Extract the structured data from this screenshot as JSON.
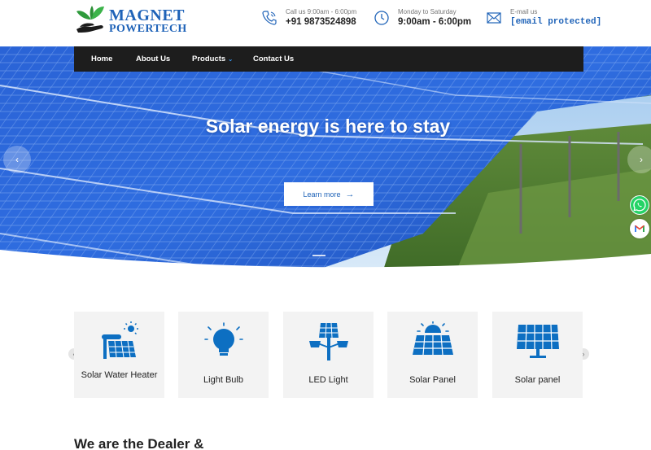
{
  "brand": {
    "line1": "MAGNET",
    "line2": "POWERTECH",
    "logo_icon": "leaf-hand-logo"
  },
  "contact": {
    "phone": {
      "label": "Call us 9:00am - 6:00pm",
      "value": "+91 9873524898",
      "icon": "phone-icon"
    },
    "hours": {
      "label": "Monday to Saturday",
      "value": "9:00am - 6:00pm",
      "icon": "clock-icon"
    },
    "email": {
      "label": "E-mail us",
      "value": "[email protected]",
      "icon": "mail-icon"
    }
  },
  "nav": {
    "items": [
      {
        "label": "Home"
      },
      {
        "label": "About Us"
      },
      {
        "label": "Products",
        "caret": "⌄"
      },
      {
        "label": "Contact Us"
      }
    ]
  },
  "hero": {
    "title": "Solar energy is here to stay",
    "button_label": "Learn more",
    "button_icon": "arrow-right-icon",
    "prev_icon": "chevron-left-icon",
    "next_icon": "chevron-right-icon"
  },
  "floating": [
    {
      "icon": "whatsapp-icon",
      "color": "#25d366"
    },
    {
      "icon": "gmail-icon",
      "color": "#ea4335"
    }
  ],
  "products": {
    "prev_icon": "chevron-left-icon",
    "next_icon": "chevron-right-icon",
    "items": [
      {
        "label": "Solar Water Heater",
        "icon": "solar-water-heater-icon"
      },
      {
        "label": "Light Bulb",
        "icon": "light-bulb-icon"
      },
      {
        "label": "LED Light",
        "icon": "led-light-icon"
      },
      {
        "label": "Solar Panel",
        "icon": "solar-panel-sun-icon"
      },
      {
        "label": "Solar panel",
        "icon": "solar-panel-icon"
      }
    ]
  },
  "section": {
    "title": "We are the Dealer &"
  },
  "colors": {
    "brand_blue": "#1f63b8",
    "nav_bg": "#1d1d1d",
    "card_bg": "#f3f3f3",
    "icon_blue": "#0d6fc2"
  }
}
